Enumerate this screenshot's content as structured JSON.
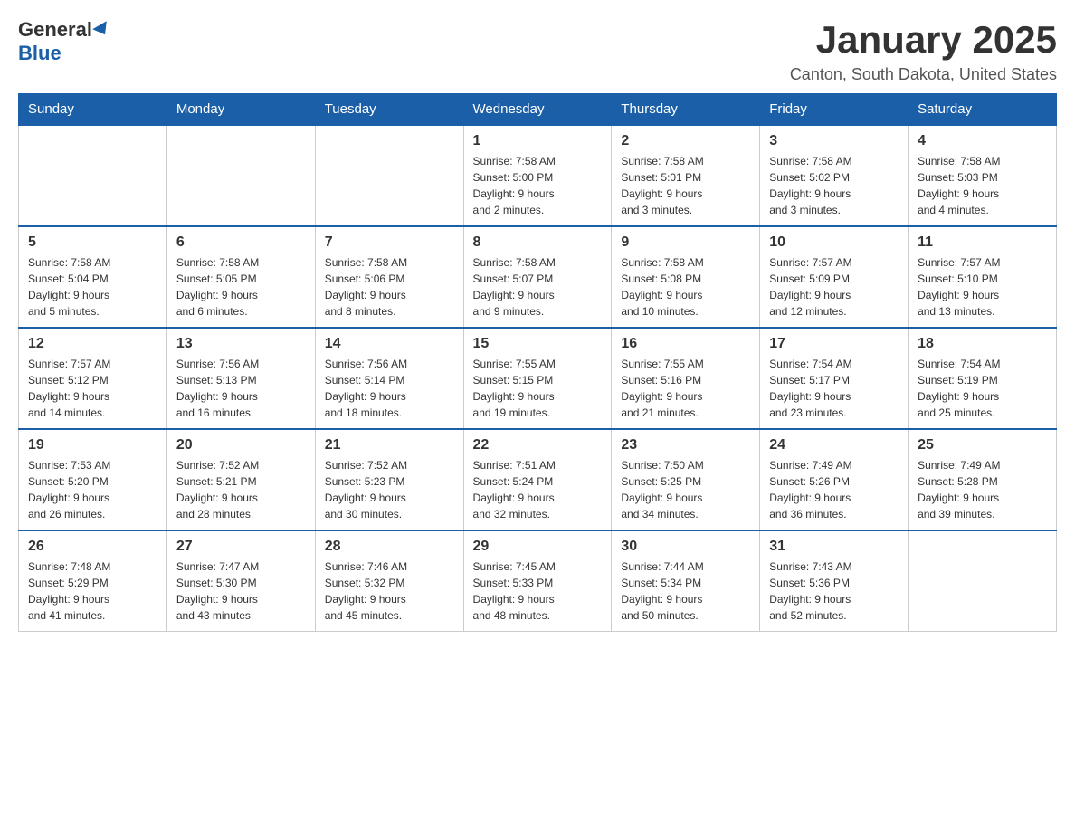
{
  "logo": {
    "part1": "General",
    "part2": "Blue"
  },
  "title": "January 2025",
  "subtitle": "Canton, South Dakota, United States",
  "weekdays": [
    "Sunday",
    "Monday",
    "Tuesday",
    "Wednesday",
    "Thursday",
    "Friday",
    "Saturday"
  ],
  "weeks": [
    [
      null,
      null,
      null,
      {
        "day": 1,
        "sunrise": "7:58 AM",
        "sunset": "5:00 PM",
        "daylight": "9 hours and 2 minutes."
      },
      {
        "day": 2,
        "sunrise": "7:58 AM",
        "sunset": "5:01 PM",
        "daylight": "9 hours and 3 minutes."
      },
      {
        "day": 3,
        "sunrise": "7:58 AM",
        "sunset": "5:02 PM",
        "daylight": "9 hours and 3 minutes."
      },
      {
        "day": 4,
        "sunrise": "7:58 AM",
        "sunset": "5:03 PM",
        "daylight": "9 hours and 4 minutes."
      }
    ],
    [
      {
        "day": 5,
        "sunrise": "7:58 AM",
        "sunset": "5:04 PM",
        "daylight": "9 hours and 5 minutes."
      },
      {
        "day": 6,
        "sunrise": "7:58 AM",
        "sunset": "5:05 PM",
        "daylight": "9 hours and 6 minutes."
      },
      {
        "day": 7,
        "sunrise": "7:58 AM",
        "sunset": "5:06 PM",
        "daylight": "9 hours and 8 minutes."
      },
      {
        "day": 8,
        "sunrise": "7:58 AM",
        "sunset": "5:07 PM",
        "daylight": "9 hours and 9 minutes."
      },
      {
        "day": 9,
        "sunrise": "7:58 AM",
        "sunset": "5:08 PM",
        "daylight": "9 hours and 10 minutes."
      },
      {
        "day": 10,
        "sunrise": "7:57 AM",
        "sunset": "5:09 PM",
        "daylight": "9 hours and 12 minutes."
      },
      {
        "day": 11,
        "sunrise": "7:57 AM",
        "sunset": "5:10 PM",
        "daylight": "9 hours and 13 minutes."
      }
    ],
    [
      {
        "day": 12,
        "sunrise": "7:57 AM",
        "sunset": "5:12 PM",
        "daylight": "9 hours and 14 minutes."
      },
      {
        "day": 13,
        "sunrise": "7:56 AM",
        "sunset": "5:13 PM",
        "daylight": "9 hours and 16 minutes."
      },
      {
        "day": 14,
        "sunrise": "7:56 AM",
        "sunset": "5:14 PM",
        "daylight": "9 hours and 18 minutes."
      },
      {
        "day": 15,
        "sunrise": "7:55 AM",
        "sunset": "5:15 PM",
        "daylight": "9 hours and 19 minutes."
      },
      {
        "day": 16,
        "sunrise": "7:55 AM",
        "sunset": "5:16 PM",
        "daylight": "9 hours and 21 minutes."
      },
      {
        "day": 17,
        "sunrise": "7:54 AM",
        "sunset": "5:17 PM",
        "daylight": "9 hours and 23 minutes."
      },
      {
        "day": 18,
        "sunrise": "7:54 AM",
        "sunset": "5:19 PM",
        "daylight": "9 hours and 25 minutes."
      }
    ],
    [
      {
        "day": 19,
        "sunrise": "7:53 AM",
        "sunset": "5:20 PM",
        "daylight": "9 hours and 26 minutes."
      },
      {
        "day": 20,
        "sunrise": "7:52 AM",
        "sunset": "5:21 PM",
        "daylight": "9 hours and 28 minutes."
      },
      {
        "day": 21,
        "sunrise": "7:52 AM",
        "sunset": "5:23 PM",
        "daylight": "9 hours and 30 minutes."
      },
      {
        "day": 22,
        "sunrise": "7:51 AM",
        "sunset": "5:24 PM",
        "daylight": "9 hours and 32 minutes."
      },
      {
        "day": 23,
        "sunrise": "7:50 AM",
        "sunset": "5:25 PM",
        "daylight": "9 hours and 34 minutes."
      },
      {
        "day": 24,
        "sunrise": "7:49 AM",
        "sunset": "5:26 PM",
        "daylight": "9 hours and 36 minutes."
      },
      {
        "day": 25,
        "sunrise": "7:49 AM",
        "sunset": "5:28 PM",
        "daylight": "9 hours and 39 minutes."
      }
    ],
    [
      {
        "day": 26,
        "sunrise": "7:48 AM",
        "sunset": "5:29 PM",
        "daylight": "9 hours and 41 minutes."
      },
      {
        "day": 27,
        "sunrise": "7:47 AM",
        "sunset": "5:30 PM",
        "daylight": "9 hours and 43 minutes."
      },
      {
        "day": 28,
        "sunrise": "7:46 AM",
        "sunset": "5:32 PM",
        "daylight": "9 hours and 45 minutes."
      },
      {
        "day": 29,
        "sunrise": "7:45 AM",
        "sunset": "5:33 PM",
        "daylight": "9 hours and 48 minutes."
      },
      {
        "day": 30,
        "sunrise": "7:44 AM",
        "sunset": "5:34 PM",
        "daylight": "9 hours and 50 minutes."
      },
      {
        "day": 31,
        "sunrise": "7:43 AM",
        "sunset": "5:36 PM",
        "daylight": "9 hours and 52 minutes."
      },
      null
    ]
  ]
}
